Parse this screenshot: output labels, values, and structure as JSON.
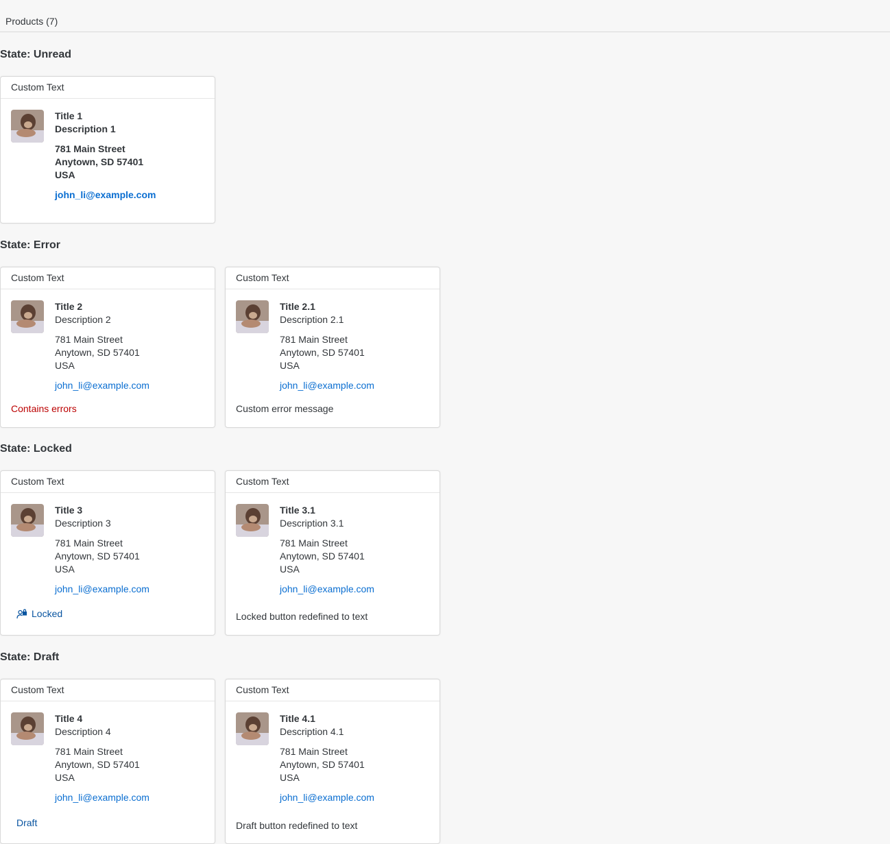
{
  "toolbar": {
    "title": "Products (7)"
  },
  "colors": {
    "link": "#0a6ed1",
    "error": "#bb0000",
    "button": "#0854a0"
  },
  "sections": {
    "unread": {
      "title": "State: Unread"
    },
    "error": {
      "title": "State: Error"
    },
    "locked": {
      "title": "State: Locked"
    },
    "draft": {
      "title": "State: Draft"
    }
  },
  "common": {
    "header": "Custom Text",
    "address_line1": "781 Main Street",
    "address_line2": "Anytown, SD 57401",
    "address_line3": "USA",
    "email": "john_li@example.com",
    "avatar_icon": "product-photo-dog"
  },
  "cards": {
    "c1": {
      "title": "Title 1",
      "description": "Description 1"
    },
    "c2": {
      "title": "Title 2",
      "description": "Description 2",
      "footer": "Contains errors"
    },
    "c21": {
      "title": "Title 2.1",
      "description": "Description 2.1",
      "footer": "Custom error message"
    },
    "c3": {
      "title": "Title 3",
      "description": "Description 3",
      "footer": "Locked",
      "footer_icon": "person-lock-icon"
    },
    "c31": {
      "title": "Title 3.1",
      "description": "Description 3.1",
      "footer": "Locked button redefined to text"
    },
    "c4": {
      "title": "Title 4",
      "description": "Description 4",
      "footer": "Draft"
    },
    "c41": {
      "title": "Title 4.1",
      "description": "Description 4.1",
      "footer": "Draft button redefined to text"
    }
  }
}
